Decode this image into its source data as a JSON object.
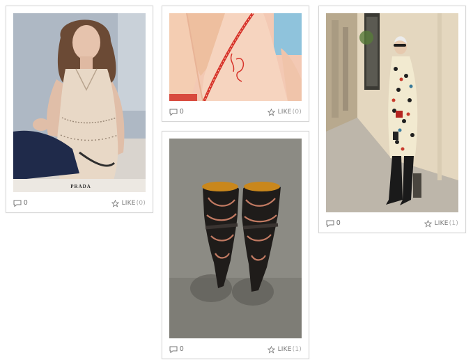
{
  "cards": [
    {
      "name": "card-prada",
      "image_caption": "PRADA",
      "comments": "0",
      "like_label": "LIKE",
      "like_count": "(0)"
    },
    {
      "name": "card-pajama",
      "image_caption": "",
      "comments": "0",
      "like_label": "LIKE",
      "like_count": "(0)"
    },
    {
      "name": "card-boots",
      "image_caption": "",
      "comments": "0",
      "like_label": "LIKE",
      "like_count": "(1)"
    },
    {
      "name": "card-street",
      "image_caption": "",
      "comments": "0",
      "like_label": "LIKE",
      "like_count": "(1)"
    }
  ],
  "icons": {
    "comment": "speech-bubble-icon",
    "like": "star-icon"
  },
  "colors": {
    "card_border": "#d6d6d6",
    "meta_text": "#666666"
  }
}
